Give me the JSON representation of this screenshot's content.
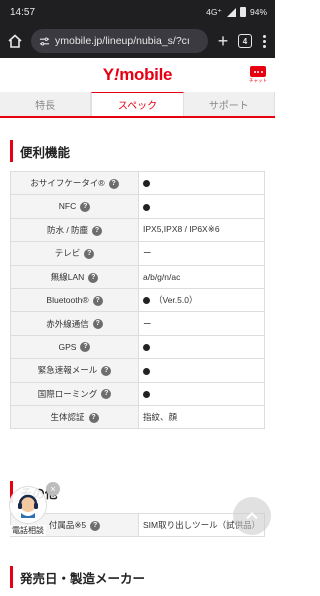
{
  "status_bar": {
    "time": "14:57",
    "network": "4G⁺",
    "battery": "94%"
  },
  "browser": {
    "url": "ymobile.jp/lineup/nubia_s/?cı",
    "tab_count": "4"
  },
  "site": {
    "logo_y": "Y",
    "logo_mark": "!",
    "logo_rest": "mobile",
    "chat_label": "チャット"
  },
  "tabs": [
    {
      "label": "特長"
    },
    {
      "label": "スペック"
    },
    {
      "label": "サポート"
    }
  ],
  "section1": {
    "title": "便利機能"
  },
  "spec_rows": [
    {
      "label": "おサイフケータイ®",
      "value": ""
    },
    {
      "label": "NFC",
      "value": ""
    },
    {
      "label": "防水 / 防塵",
      "value": "IPX5,IPX8 / IP6X※6"
    },
    {
      "label": "テレビ",
      "value": "ー"
    },
    {
      "label": "無線LAN",
      "value": "a/b/g/n/ac"
    },
    {
      "label": "Bluetooth®",
      "value": "（Ver.5.0）"
    },
    {
      "label": "赤外線通信",
      "value": "ー"
    },
    {
      "label": "GPS",
      "value": ""
    },
    {
      "label": "緊急速報メール",
      "value": ""
    },
    {
      "label": "国際ローミング",
      "value": ""
    },
    {
      "label": "生体認証",
      "value": "指紋、顔"
    }
  ],
  "section2": {
    "title": "その他"
  },
  "other_rows": [
    {
      "label": "付属品※5",
      "value": "SIM取り出しツール（試供品）"
    }
  ],
  "section3": {
    "title": "発売日・製造メーカー"
  },
  "call_fab": {
    "label": "電話相談"
  },
  "icons": {
    "help": "?",
    "close": "×"
  },
  "colors": {
    "brand": "#e60012"
  }
}
